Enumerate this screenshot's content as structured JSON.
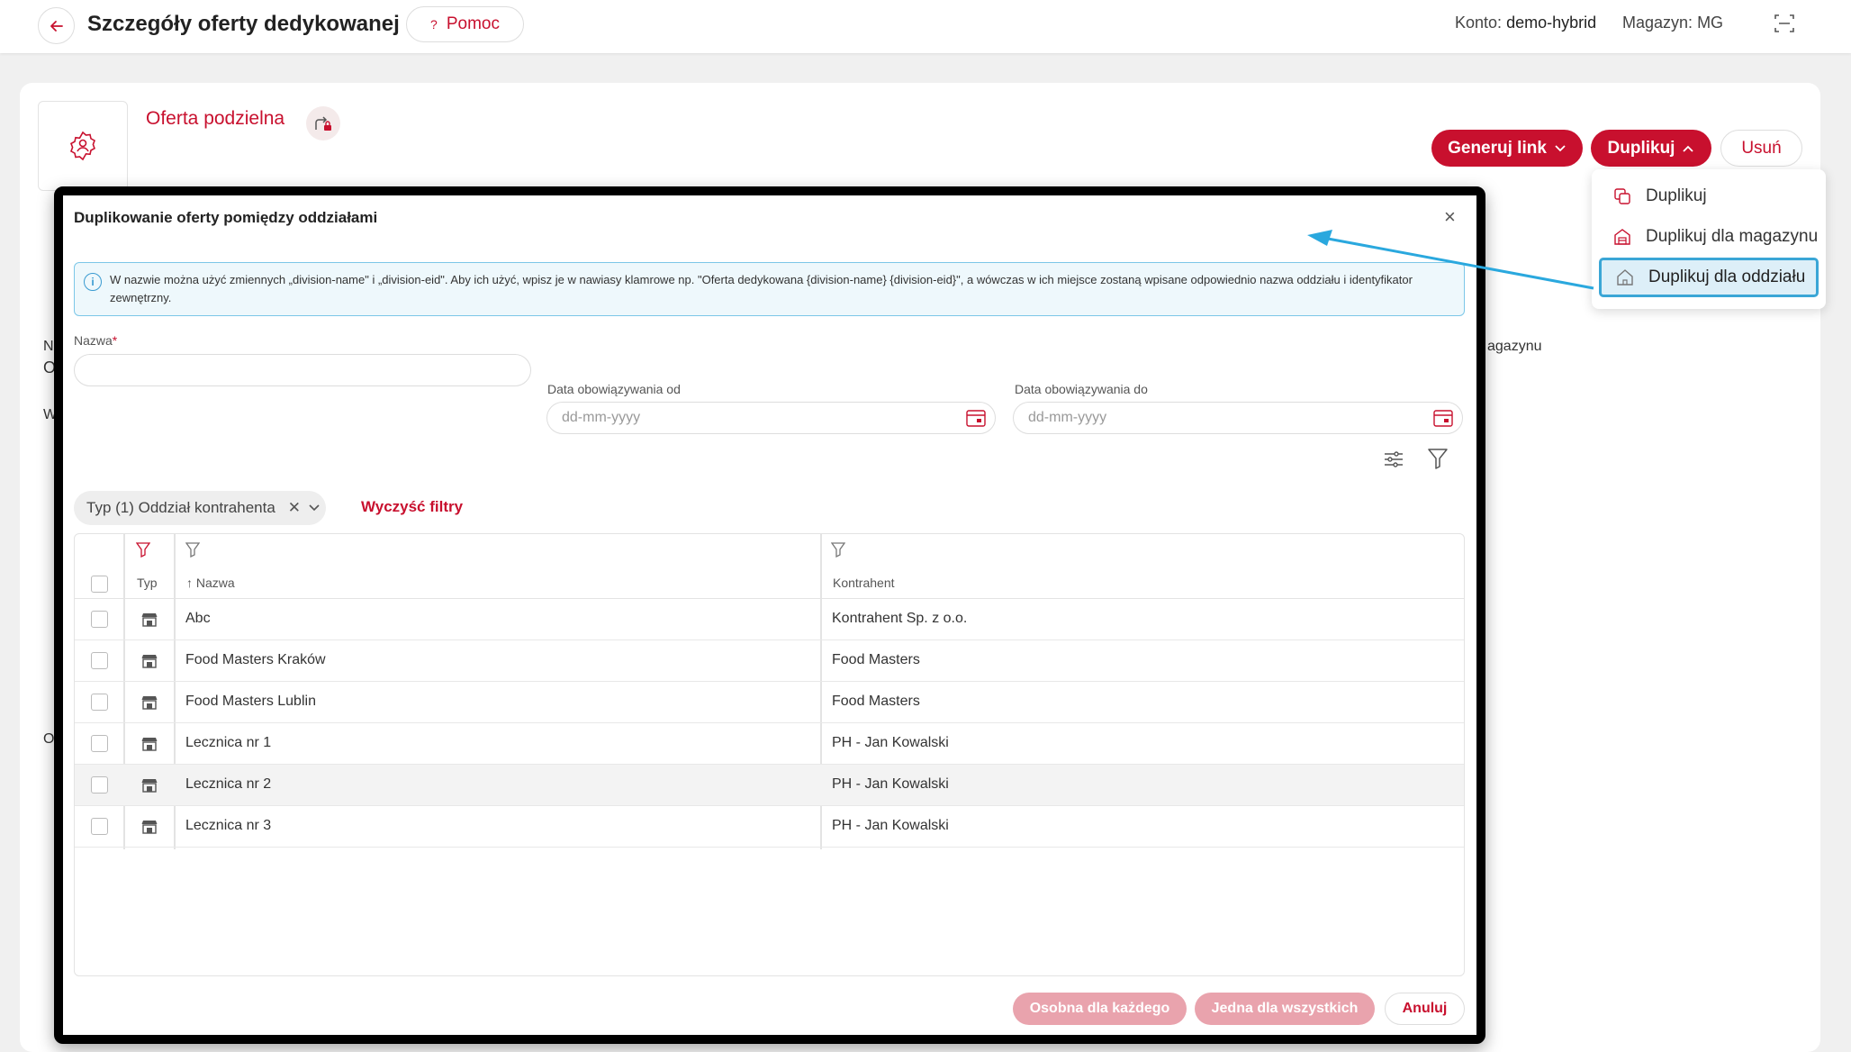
{
  "header": {
    "title": "Szczegóły oferty dedykowanej",
    "help_label": "Pomoc",
    "account_label": "Konto:",
    "account_value": "demo-hybrid",
    "warehouse_label": "Magazyn:",
    "warehouse_value": "MG"
  },
  "offer": {
    "title": "Oferta podzielna",
    "buttons": {
      "generate_link": "Generuj link",
      "duplicate": "Duplikuj",
      "delete": "Usuń"
    }
  },
  "duplicate_menu": {
    "items": [
      {
        "label": "Duplikuj",
        "icon": "copy-icon"
      },
      {
        "label": "Duplikuj dla magazynu",
        "icon": "warehouse-icon"
      },
      {
        "label": "Duplikuj dla oddziału",
        "icon": "home-icon"
      }
    ]
  },
  "background_fragments": {
    "f1": "N",
    "f2": "O",
    "f3": "W",
    "f4": "O",
    "f5": "agazynu"
  },
  "modal": {
    "title": "Duplikowanie oferty pomiędzy oddziałami",
    "info": "W nazwie można użyć zmiennych „division-name\" i „division-eid\". Aby ich użyć, wpisz je w nawiasy klamrowe np. \"Oferta dedykowana {division-name} {division-eid}\", a wówczas w ich miejsce zostaną wpisane odpowiednio nazwa oddziału i identyfikator zewnętrzny.",
    "name_label": "Nazwa",
    "name_required": "*",
    "name_value": "",
    "date_from_label": "Data obowiązywania od",
    "date_from_placeholder": "dd-mm-yyyy",
    "date_to_label": "Data obowiązywania do",
    "date_to_placeholder": "dd-mm-yyyy",
    "filter_chip": "Typ (1) Oddział kontrahenta",
    "clear_filters": "Wyczyść filtry",
    "table": {
      "columns": {
        "type": "Typ",
        "name": "Nazwa",
        "contractor": "Kontrahent"
      },
      "rows": [
        {
          "name": "Abc",
          "contractor": "Kontrahent Sp. z o.o."
        },
        {
          "name": "Food Masters Kraków",
          "contractor": "Food Masters"
        },
        {
          "name": "Food Masters Lublin",
          "contractor": "Food Masters"
        },
        {
          "name": "Lecznica nr 1",
          "contractor": "PH - Jan Kowalski"
        },
        {
          "name": "Lecznica nr 2",
          "contractor": "PH - Jan Kowalski"
        },
        {
          "name": "Lecznica nr 3",
          "contractor": "PH - Jan Kowalski"
        }
      ]
    },
    "footer": {
      "separate": "Osobna dla każdego",
      "single": "Jedna dla wszystkich",
      "cancel": "Anuluj"
    }
  },
  "colors": {
    "brand": "#c8102e",
    "brand_disabled": "#e9a3ad",
    "info_border": "#7cc7e8",
    "highlight": "#3aa6d6"
  }
}
